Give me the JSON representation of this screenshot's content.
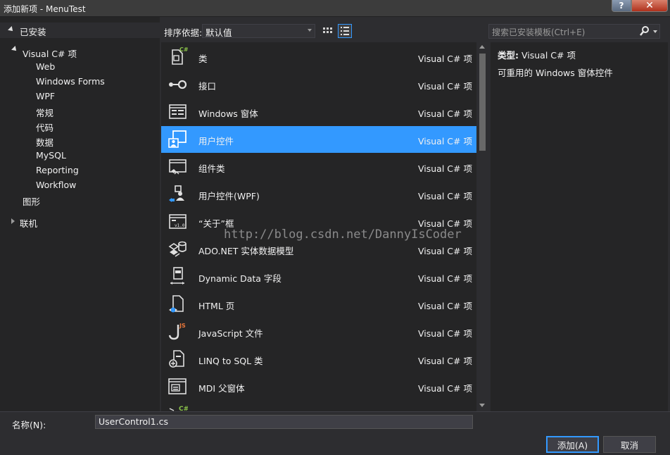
{
  "window": {
    "title": "添加新项 - MenuTest",
    "help": "?",
    "close": "✕"
  },
  "left": {
    "installed_label": "已安装",
    "tree": [
      {
        "label": "Visual C# 项",
        "expanded": true
      },
      {
        "label": "Web"
      },
      {
        "label": "Windows Forms"
      },
      {
        "label": "WPF"
      },
      {
        "label": "常规"
      },
      {
        "label": "代码"
      },
      {
        "label": "数据"
      },
      {
        "label": "MySQL"
      },
      {
        "label": "Reporting"
      },
      {
        "label": "Workflow"
      },
      {
        "label": "图形"
      },
      {
        "label": "联机",
        "expanded": false
      }
    ]
  },
  "toolbar": {
    "sort_label": "排序依据:",
    "sort_value": "默认值"
  },
  "search": {
    "placeholder": "搜索已安装模板(Ctrl+E)"
  },
  "templates": [
    {
      "name": "类",
      "category": "Visual C# 项",
      "icon": "class-icon"
    },
    {
      "name": "接口",
      "category": "Visual C# 项",
      "icon": "interface-icon"
    },
    {
      "name": "Windows 窗体",
      "category": "Visual C# 项",
      "icon": "windows-form-icon"
    },
    {
      "name": "用户控件",
      "category": "Visual C# 项",
      "icon": "user-control-icon",
      "selected": true
    },
    {
      "name": "组件类",
      "category": "Visual C# 项",
      "icon": "component-class-icon"
    },
    {
      "name": "用户控件(WPF)",
      "category": "Visual C# 项",
      "icon": "wpf-user-control-icon"
    },
    {
      "name": "“关于”框",
      "category": "Visual C# 项",
      "icon": "about-box-icon"
    },
    {
      "name": "ADO.NET 实体数据模型",
      "category": "Visual C# 项",
      "icon": "entity-model-icon"
    },
    {
      "name": "Dynamic Data 字段",
      "category": "Visual C# 项",
      "icon": "dynamic-data-icon"
    },
    {
      "name": "HTML 页",
      "category": "Visual C# 项",
      "icon": "html-page-icon"
    },
    {
      "name": "JavaScript 文件",
      "category": "Visual C# 项",
      "icon": "javascript-file-icon"
    },
    {
      "name": "LINQ to SQL 类",
      "category": "Visual C# 项",
      "icon": "linq-to-sql-icon"
    },
    {
      "name": "MDI 父窗体",
      "category": "Visual C# 项",
      "icon": "mdi-parent-icon"
    }
  ],
  "details": {
    "type_label": "类型:",
    "type_value": "Visual C# 项",
    "description": "可重用的 Windows 窗体控件"
  },
  "watermark": "http://blog.csdn.net/DannyIsCoder",
  "bottom": {
    "name_label": "名称(N):",
    "name_value": "UserControl1.cs",
    "add_label": "添加(A)",
    "cancel_label": "取消"
  },
  "colors": {
    "selection": "#3399ff",
    "background": "#2d2d30",
    "panel": "#252526"
  }
}
